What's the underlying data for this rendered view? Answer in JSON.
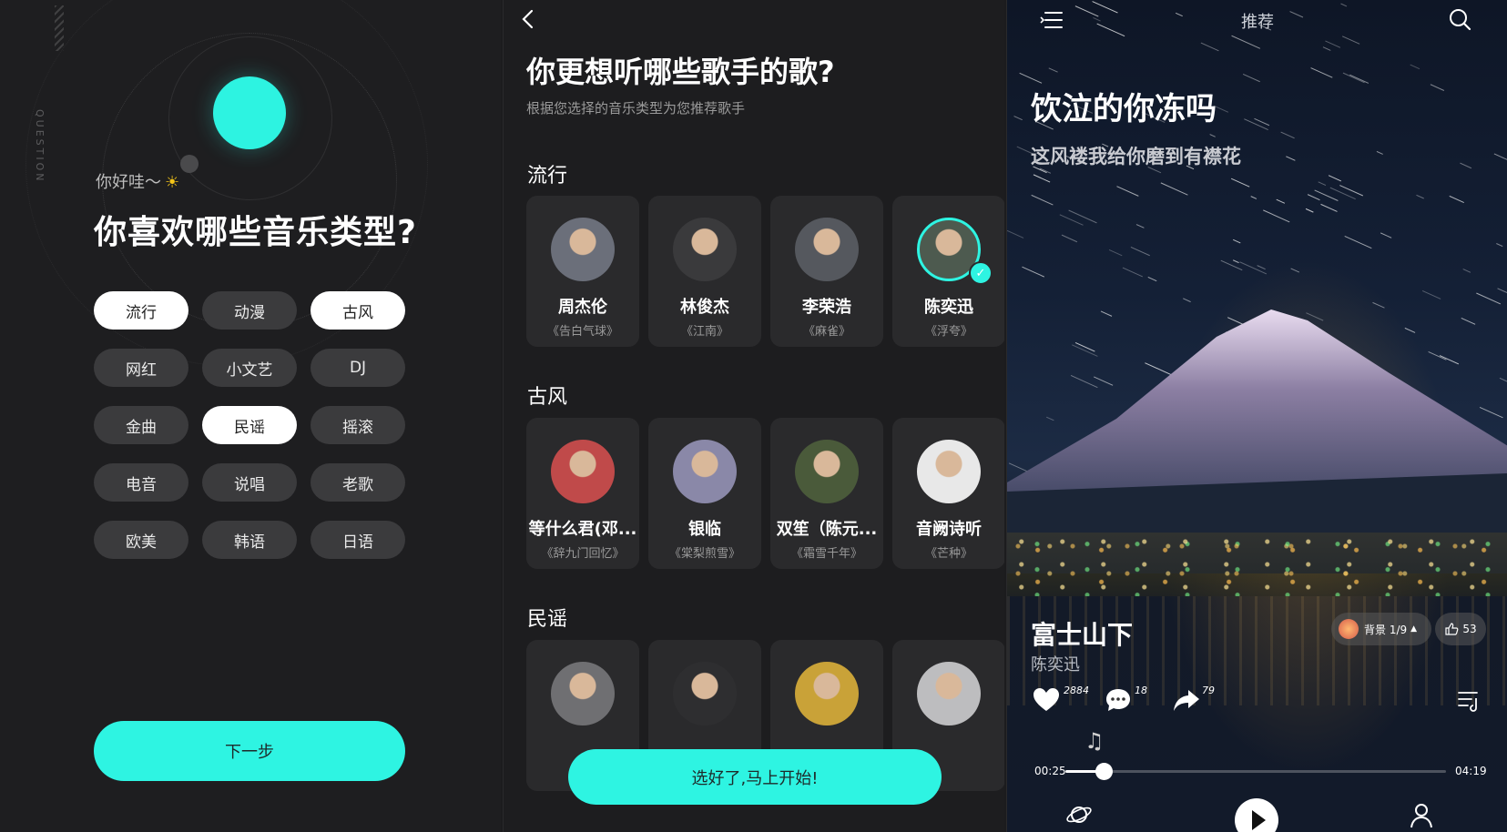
{
  "onboarding": {
    "vertical_label": "QUESTION",
    "greeting": "你好哇～",
    "greeting_icon": "sun-icon",
    "title": "你喜欢哪些音乐类型?",
    "genres": [
      {
        "label": "流行",
        "selected": true
      },
      {
        "label": "动漫",
        "selected": false
      },
      {
        "label": "古风",
        "selected": true
      },
      {
        "label": "网红",
        "selected": false
      },
      {
        "label": "小文艺",
        "selected": false
      },
      {
        "label": "DJ",
        "selected": false
      },
      {
        "label": "金曲",
        "selected": false
      },
      {
        "label": "民谣",
        "selected": true
      },
      {
        "label": "摇滚",
        "selected": false
      },
      {
        "label": "电音",
        "selected": false
      },
      {
        "label": "说唱",
        "selected": false
      },
      {
        "label": "老歌",
        "selected": false
      },
      {
        "label": "欧美",
        "selected": false
      },
      {
        "label": "韩语",
        "selected": false
      },
      {
        "label": "日语",
        "selected": false
      }
    ],
    "next_button": "下一步",
    "accent_color": "#2EF4E2"
  },
  "artists": {
    "title": "你更想听哪些歌手的歌?",
    "subtitle": "根据您选择的音乐类型为您推荐歌手",
    "sections": [
      {
        "name": "流行",
        "cards": [
          {
            "name": "周杰伦",
            "song": "《告白气球》",
            "checked": false
          },
          {
            "name": "林俊杰",
            "song": "《江南》",
            "checked": false
          },
          {
            "name": "李荣浩",
            "song": "《麻雀》",
            "checked": false
          },
          {
            "name": "陈奕迅",
            "song": "《浮夸》",
            "checked": true
          }
        ]
      },
      {
        "name": "古风",
        "cards": [
          {
            "name": "等什么君(邓...",
            "song": "《辞九门回忆》",
            "checked": false
          },
          {
            "name": "银临",
            "song": "《棠梨煎雪》",
            "checked": false
          },
          {
            "name": "双笙（陈元...",
            "song": "《霜雪千年》",
            "checked": false
          },
          {
            "name": "音阙诗听",
            "song": "《芒种》",
            "checked": false
          }
        ]
      },
      {
        "name": "民谣",
        "cards": [
          {
            "name": "",
            "song": "",
            "checked": false
          },
          {
            "name": "",
            "song": "",
            "checked": false
          },
          {
            "name": "",
            "song": "",
            "checked": false
          },
          {
            "name": "",
            "song": "",
            "checked": false
          }
        ]
      }
    ],
    "start_button": "选好了,马上开始!"
  },
  "player": {
    "top_title": "推荐",
    "lyric_main": "饮泣的你冻吗",
    "lyric_sub": "这风褛我给你磨到有襟花",
    "song_title": "富士山下",
    "artist": "陈奕迅",
    "background_label": "背景 1/9",
    "like_count": "53",
    "actions": {
      "hearts": "2884",
      "comments": "18",
      "shares": "79"
    },
    "time_current": "00:25",
    "time_total": "04:19",
    "progress": 0.1
  }
}
